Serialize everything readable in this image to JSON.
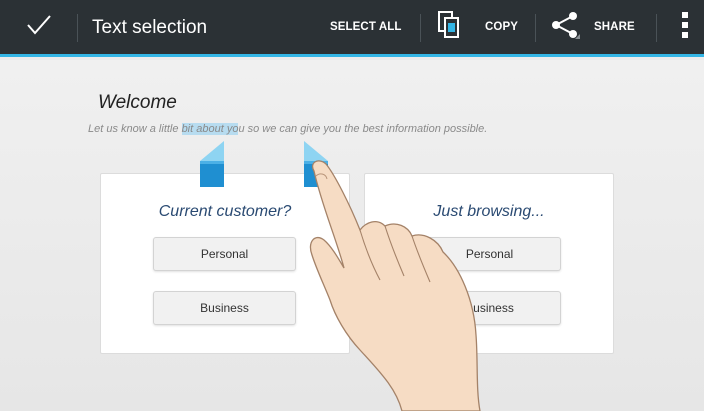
{
  "action_bar": {
    "title": "Text selection",
    "select_all": "SELECT ALL",
    "copy": "COPY",
    "share": "SHARE",
    "done_icon": "checkmark-icon",
    "copy_icon": "copy-icon",
    "share_icon": "share-icon",
    "overflow_icon": "overflow-menu-icon",
    "accent_color": "#33b5e5",
    "bar_color": "#2b3135"
  },
  "page": {
    "welcome": "Welcome",
    "intro_before": "Let us know a little ",
    "intro_selected": "bit about yo",
    "intro_after": "u so we can give you the best information possible."
  },
  "cards": [
    {
      "title": "Current customer?",
      "buttons": [
        "Personal",
        "Business"
      ]
    },
    {
      "title": "Just browsing...",
      "buttons": [
        "Personal",
        "Business"
      ]
    }
  ]
}
